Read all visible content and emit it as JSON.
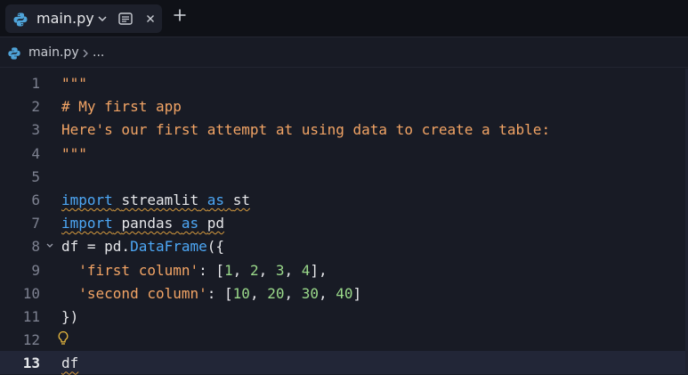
{
  "tab": {
    "label": "main.py"
  },
  "breadcrumb": {
    "file": "main.py",
    "more": "..."
  },
  "editor": {
    "lines": [
      {
        "n": "1",
        "tokens": [
          {
            "t": "\"\"\"",
            "c": "str"
          }
        ]
      },
      {
        "n": "2",
        "tokens": [
          {
            "t": "# My first app",
            "c": "com"
          }
        ]
      },
      {
        "n": "3",
        "tokens": [
          {
            "t": "Here's our first attempt at using data to create a table:",
            "c": "str"
          }
        ]
      },
      {
        "n": "4",
        "tokens": [
          {
            "t": "\"\"\"",
            "c": "str"
          }
        ]
      },
      {
        "n": "5",
        "tokens": []
      },
      {
        "n": "6",
        "tokens": [
          {
            "t": "import",
            "c": "kw",
            "s": 1
          },
          {
            "t": " ",
            "c": "plain",
            "s": 1
          },
          {
            "t": "streamlit",
            "c": "plain",
            "s": 1
          },
          {
            "t": " ",
            "c": "plain",
            "s": 1
          },
          {
            "t": "as",
            "c": "kw",
            "s": 1
          },
          {
            "t": " ",
            "c": "plain",
            "s": 1
          },
          {
            "t": "st",
            "c": "plain",
            "s": 1
          }
        ]
      },
      {
        "n": "7",
        "tokens": [
          {
            "t": "import",
            "c": "kw",
            "s": 1
          },
          {
            "t": " ",
            "c": "plain",
            "s": 1
          },
          {
            "t": "pandas",
            "c": "plain",
            "s": 1
          },
          {
            "t": " ",
            "c": "plain",
            "s": 1
          },
          {
            "t": "as",
            "c": "kw",
            "s": 1
          },
          {
            "t": " ",
            "c": "plain",
            "s": 1
          },
          {
            "t": "pd",
            "c": "plain",
            "s": 1
          }
        ]
      },
      {
        "n": "8",
        "fold": true,
        "tokens": [
          {
            "t": "df = pd.",
            "c": "plain"
          },
          {
            "t": "DataFrame",
            "c": "fn"
          },
          {
            "t": "({",
            "c": "plain"
          }
        ]
      },
      {
        "n": "9",
        "tokens": [
          {
            "t": "  ",
            "c": "plain"
          },
          {
            "t": "'first column'",
            "c": "sq"
          },
          {
            "t": ": [",
            "c": "plain"
          },
          {
            "t": "1",
            "c": "num"
          },
          {
            "t": ", ",
            "c": "plain"
          },
          {
            "t": "2",
            "c": "num"
          },
          {
            "t": ", ",
            "c": "plain"
          },
          {
            "t": "3",
            "c": "num"
          },
          {
            "t": ", ",
            "c": "plain"
          },
          {
            "t": "4",
            "c": "num"
          },
          {
            "t": "],",
            "c": "plain"
          }
        ]
      },
      {
        "n": "10",
        "tokens": [
          {
            "t": "  ",
            "c": "plain"
          },
          {
            "t": "'second column'",
            "c": "sq"
          },
          {
            "t": ": [",
            "c": "plain"
          },
          {
            "t": "10",
            "c": "num"
          },
          {
            "t": ", ",
            "c": "plain"
          },
          {
            "t": "20",
            "c": "num"
          },
          {
            "t": ", ",
            "c": "plain"
          },
          {
            "t": "30",
            "c": "num"
          },
          {
            "t": ", ",
            "c": "plain"
          },
          {
            "t": "40",
            "c": "num"
          },
          {
            "t": "]",
            "c": "plain"
          }
        ]
      },
      {
        "n": "11",
        "tokens": [
          {
            "t": "})",
            "c": "plain"
          }
        ]
      },
      {
        "n": "12",
        "bulb": true,
        "tokens": []
      },
      {
        "n": "13",
        "current": true,
        "tokens": [
          {
            "t": "df",
            "c": "plain",
            "s": 1
          }
        ]
      }
    ]
  },
  "colors": {
    "keyword": "#4da7f5",
    "string": "#f2a465",
    "number": "#9ad98a",
    "background": "#181b25"
  }
}
